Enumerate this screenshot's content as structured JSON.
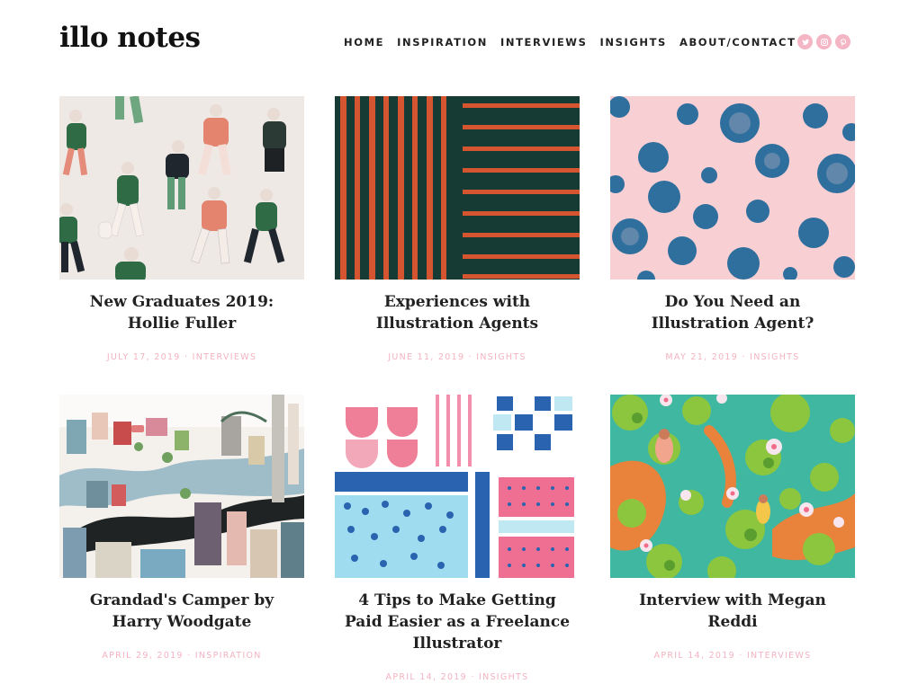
{
  "site": {
    "logo": "illo notes"
  },
  "nav": {
    "items": [
      {
        "label": "HOME"
      },
      {
        "label": "INSPIRATION"
      },
      {
        "label": "INTERVIEWS"
      },
      {
        "label": "INSIGHTS"
      },
      {
        "label": "ABOUT/CONTACT"
      }
    ]
  },
  "social": {
    "icons": [
      "twitter-icon",
      "instagram-icon",
      "pinterest-icon"
    ],
    "color": "#f4b6c4"
  },
  "colors": {
    "meta_pink": "#f3b3c1",
    "text_dark": "#222222"
  },
  "posts": [
    {
      "title": "New Graduates 2019: Hollie Fuller",
      "date": "JULY 17, 2019",
      "sep": "·",
      "category": "INTERVIEWS"
    },
    {
      "title": "Experiences with Illustration Agents",
      "date": "JUNE 11, 2019",
      "sep": "·",
      "category": "INSIGHTS"
    },
    {
      "title": "Do You Need an Illustration Agent?",
      "date": "MAY 21, 2019",
      "sep": "·",
      "category": "INSIGHTS"
    },
    {
      "title": "Grandad's Camper by Harry Woodgate",
      "date": "APRIL 29, 2019",
      "sep": "·",
      "category": "INSPIRATION"
    },
    {
      "title": "4 Tips to Make Getting Paid Easier as a Freelance Illustrator",
      "date": "APRIL 14, 2019",
      "sep": "·",
      "category": "INSIGHTS"
    },
    {
      "title": "Interview with Megan Reddi",
      "date": "APRIL 14, 2019",
      "sep": "·",
      "category": "INTERVIEWS"
    }
  ]
}
